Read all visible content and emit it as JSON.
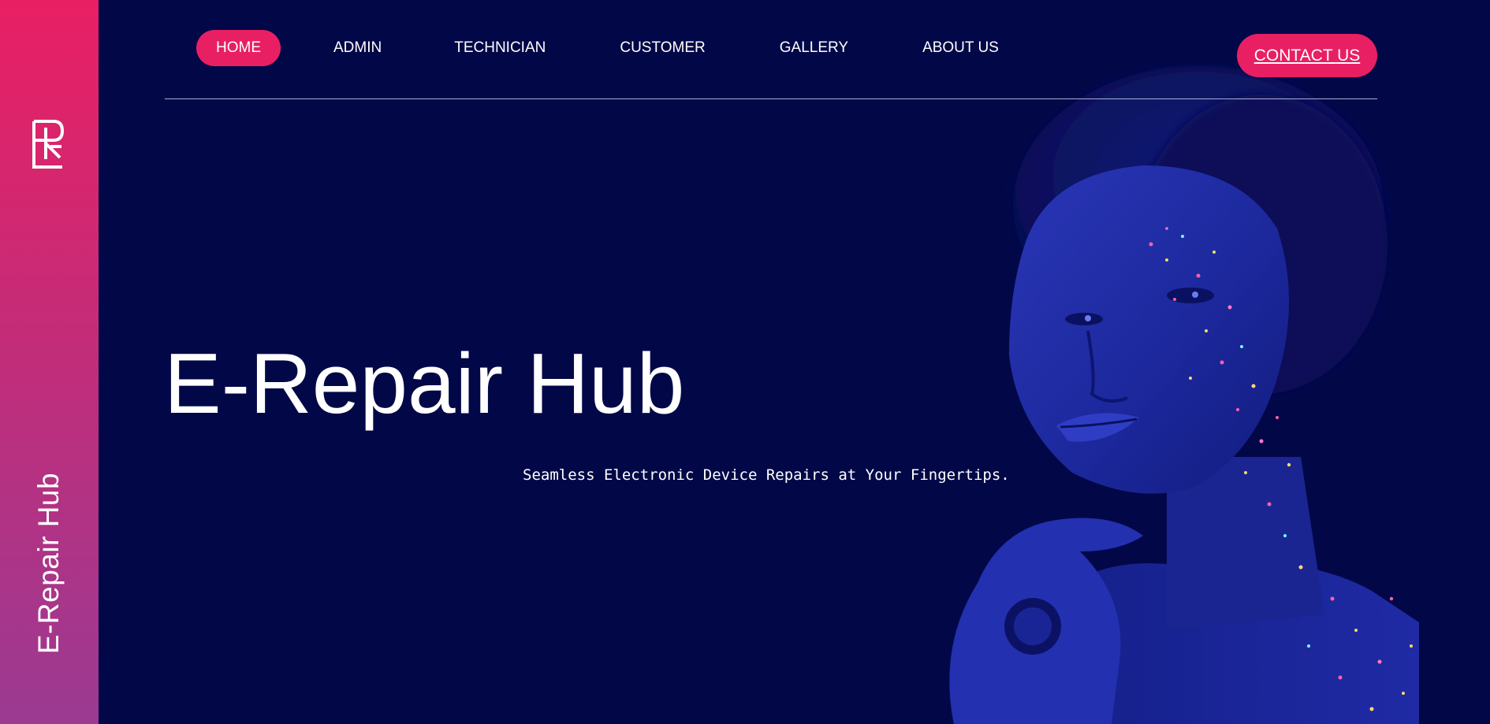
{
  "sidebar": {
    "logo_icon": "rh-monogram-logo-icon",
    "brand_text": "E-Repair Hub"
  },
  "nav": {
    "items": [
      {
        "label": "HOME",
        "active": true
      },
      {
        "label": "ADMIN",
        "active": false
      },
      {
        "label": "TECHNICIAN",
        "active": false
      },
      {
        "label": "CUSTOMER",
        "active": false
      },
      {
        "label": "GALLERY",
        "active": false
      },
      {
        "label": "ABOUT US",
        "active": false
      }
    ],
    "contact_label": "CONTACT US"
  },
  "hero": {
    "title": "E-Repair Hub",
    "subtitle": "Seamless Electronic Device Repairs at Your Fingertips.",
    "image": "glitter-face-portrait"
  },
  "colors": {
    "background": "#020847",
    "accent": "#e91f63",
    "sidebar_gradient_end": "#9b3a92",
    "text": "#ffffff"
  }
}
